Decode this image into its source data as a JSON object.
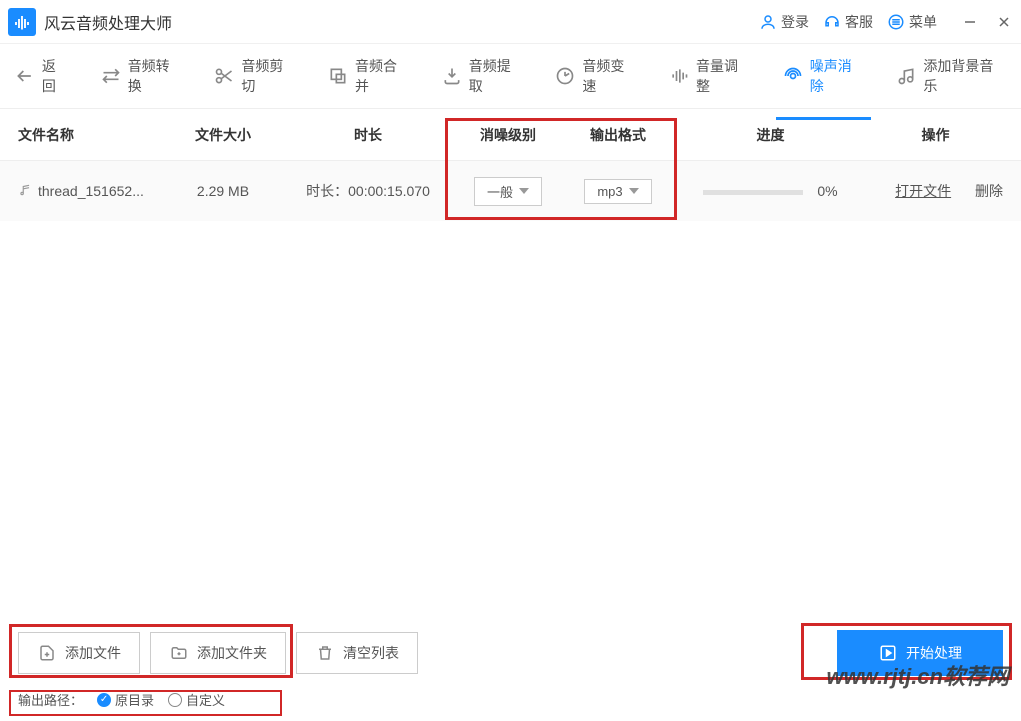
{
  "app": {
    "title": "风云音频处理大师"
  },
  "titlebar": {
    "login": "登录",
    "support": "客服",
    "menu": "菜单"
  },
  "toolbar": {
    "back": "返回",
    "convert": "音频转换",
    "cut": "音频剪切",
    "merge": "音频合并",
    "extract": "音频提取",
    "speed": "音频变速",
    "volume": "音量调整",
    "denoise": "噪声消除",
    "bgm": "添加背景音乐"
  },
  "columns": {
    "name": "文件名称",
    "size": "文件大小",
    "duration": "时长",
    "level": "消噪级别",
    "format": "输出格式",
    "progress": "进度",
    "ops": "操作"
  },
  "rows": [
    {
      "name": "thread_151652...",
      "size": "2.29 MB",
      "duration_label": "时长：",
      "duration": "00:00:15.070",
      "level": "一般",
      "format": "mp3",
      "progress_pct": "0%",
      "open": "打开文件",
      "delete": "删除"
    }
  ],
  "bottom": {
    "add_file": "添加文件",
    "add_folder": "添加文件夹",
    "clear": "清空列表",
    "start": "开始处理",
    "path_label": "输出路径：",
    "path_original": "原目录",
    "path_custom": "自定义"
  },
  "watermark": "www.rjtj.cn软荐网"
}
